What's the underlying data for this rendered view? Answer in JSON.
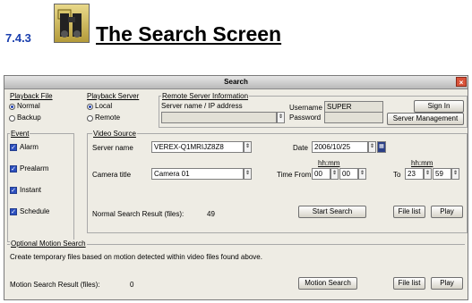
{
  "doc": {
    "section_number": "7.4.3",
    "heading": "The Search Screen"
  },
  "window": {
    "title": "Search",
    "close_glyph": "×",
    "playback_file": {
      "label": "Playback File",
      "options": [
        "Normal",
        "Backup"
      ],
      "selected": "Normal"
    },
    "playback_server": {
      "label": "Playback Server",
      "options": [
        "Local",
        "Remote"
      ],
      "selected": "Local"
    },
    "remote_server": {
      "label": "Remote Server Information",
      "server_label": "Server name / IP address",
      "server_value": "",
      "username_label": "Username",
      "username_value": "SUPER",
      "password_label": "Password",
      "password_value": "",
      "sign_in": "Sign In",
      "server_management": "Server Management"
    },
    "event": {
      "label": "Event",
      "items": [
        {
          "label": "Alarm",
          "checked": true
        },
        {
          "label": "Prealarm",
          "checked": true
        },
        {
          "label": "Instant",
          "checked": true
        },
        {
          "label": "Schedule",
          "checked": true
        }
      ]
    },
    "video_source": {
      "label": "Video Source",
      "server_name_label": "Server name",
      "server_name_value": "VEREX-Q1MRIJZ8Z8",
      "camera_title_label": "Camera title",
      "camera_title_value": "Camera 01",
      "date_label": "Date",
      "date_value": "2006/10/25",
      "time_from_label": "Time From",
      "hhmm_label": "hh:mm",
      "from_hh": "00",
      "from_mm": "00",
      "to_label": "To",
      "to_hh": "23",
      "to_mm": "59",
      "start_search": "Start Search",
      "file_list": "File list",
      "play": "Play",
      "result_label": "Normal Search Result (files):",
      "result_value": "49"
    },
    "motion": {
      "label": "Optional Motion Search",
      "description": "Create temporary files based on motion detected within video files found above.",
      "result_label": "Motion Search Result (files):",
      "result_value": "0",
      "motion_search": "Motion Search",
      "file_list": "File list",
      "play": "Play"
    },
    "spinner_glyph": "⇕",
    "calendar_glyph": "▦"
  }
}
